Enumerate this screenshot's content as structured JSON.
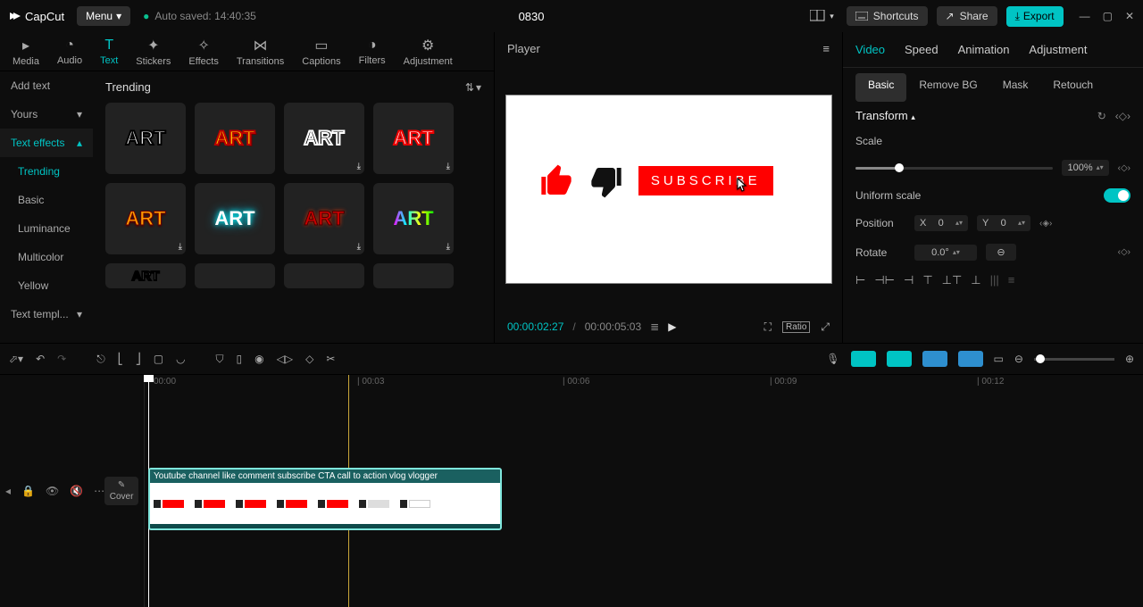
{
  "topbar": {
    "brand": "CapCut",
    "menu": "Menu",
    "autosave": "Auto saved: 14:40:35",
    "project_title": "0830",
    "shortcuts": "Shortcuts",
    "share": "Share",
    "export": "Export"
  },
  "ribbon_tabs": {
    "media": "Media",
    "audio": "Audio",
    "text": "Text",
    "stickers": "Stickers",
    "effects": "Effects",
    "transitions": "Transitions",
    "captions": "Captions",
    "filters": "Filters",
    "adjustment": "Adjustment"
  },
  "text_sidebar": {
    "add_text": "Add text",
    "yours": "Yours",
    "text_effects": "Text effects",
    "trending": "Trending",
    "basic": "Basic",
    "luminance": "Luminance",
    "multicolor": "Multicolor",
    "yellow": "Yellow",
    "text_templates": "Text templ..."
  },
  "content": {
    "heading": "Trending",
    "tile_label": "ART"
  },
  "player": {
    "title": "Player",
    "subscribe": "SUBSCRIBE",
    "current_time": "00:00:02:27",
    "total_time": "00:00:05:03",
    "ratio": "Ratio"
  },
  "inspector": {
    "tabs": {
      "video": "Video",
      "speed": "Speed",
      "animation": "Animation",
      "adjustment": "Adjustment"
    },
    "subtabs": {
      "basic": "Basic",
      "remove_bg": "Remove BG",
      "mask": "Mask",
      "retouch": "Retouch"
    },
    "transform": "Transform",
    "scale_label": "Scale",
    "scale_value": "100%",
    "uniform_scale": "Uniform scale",
    "position_label": "Position",
    "pos_x_label": "X",
    "pos_x_val": "0",
    "pos_y_label": "Y",
    "pos_y_val": "0",
    "rotate_label": "Rotate",
    "rotate_val": "0.0°"
  },
  "timeline": {
    "cover": "Cover",
    "ruler": {
      "t0": "00:00",
      "t3": "| 00:03",
      "t6": "| 00:06",
      "t9": "| 00:09",
      "t12": "| 00:12"
    },
    "clip_label": "Youtube channel like comment subscribe CTA call to action vlog vlogger"
  }
}
